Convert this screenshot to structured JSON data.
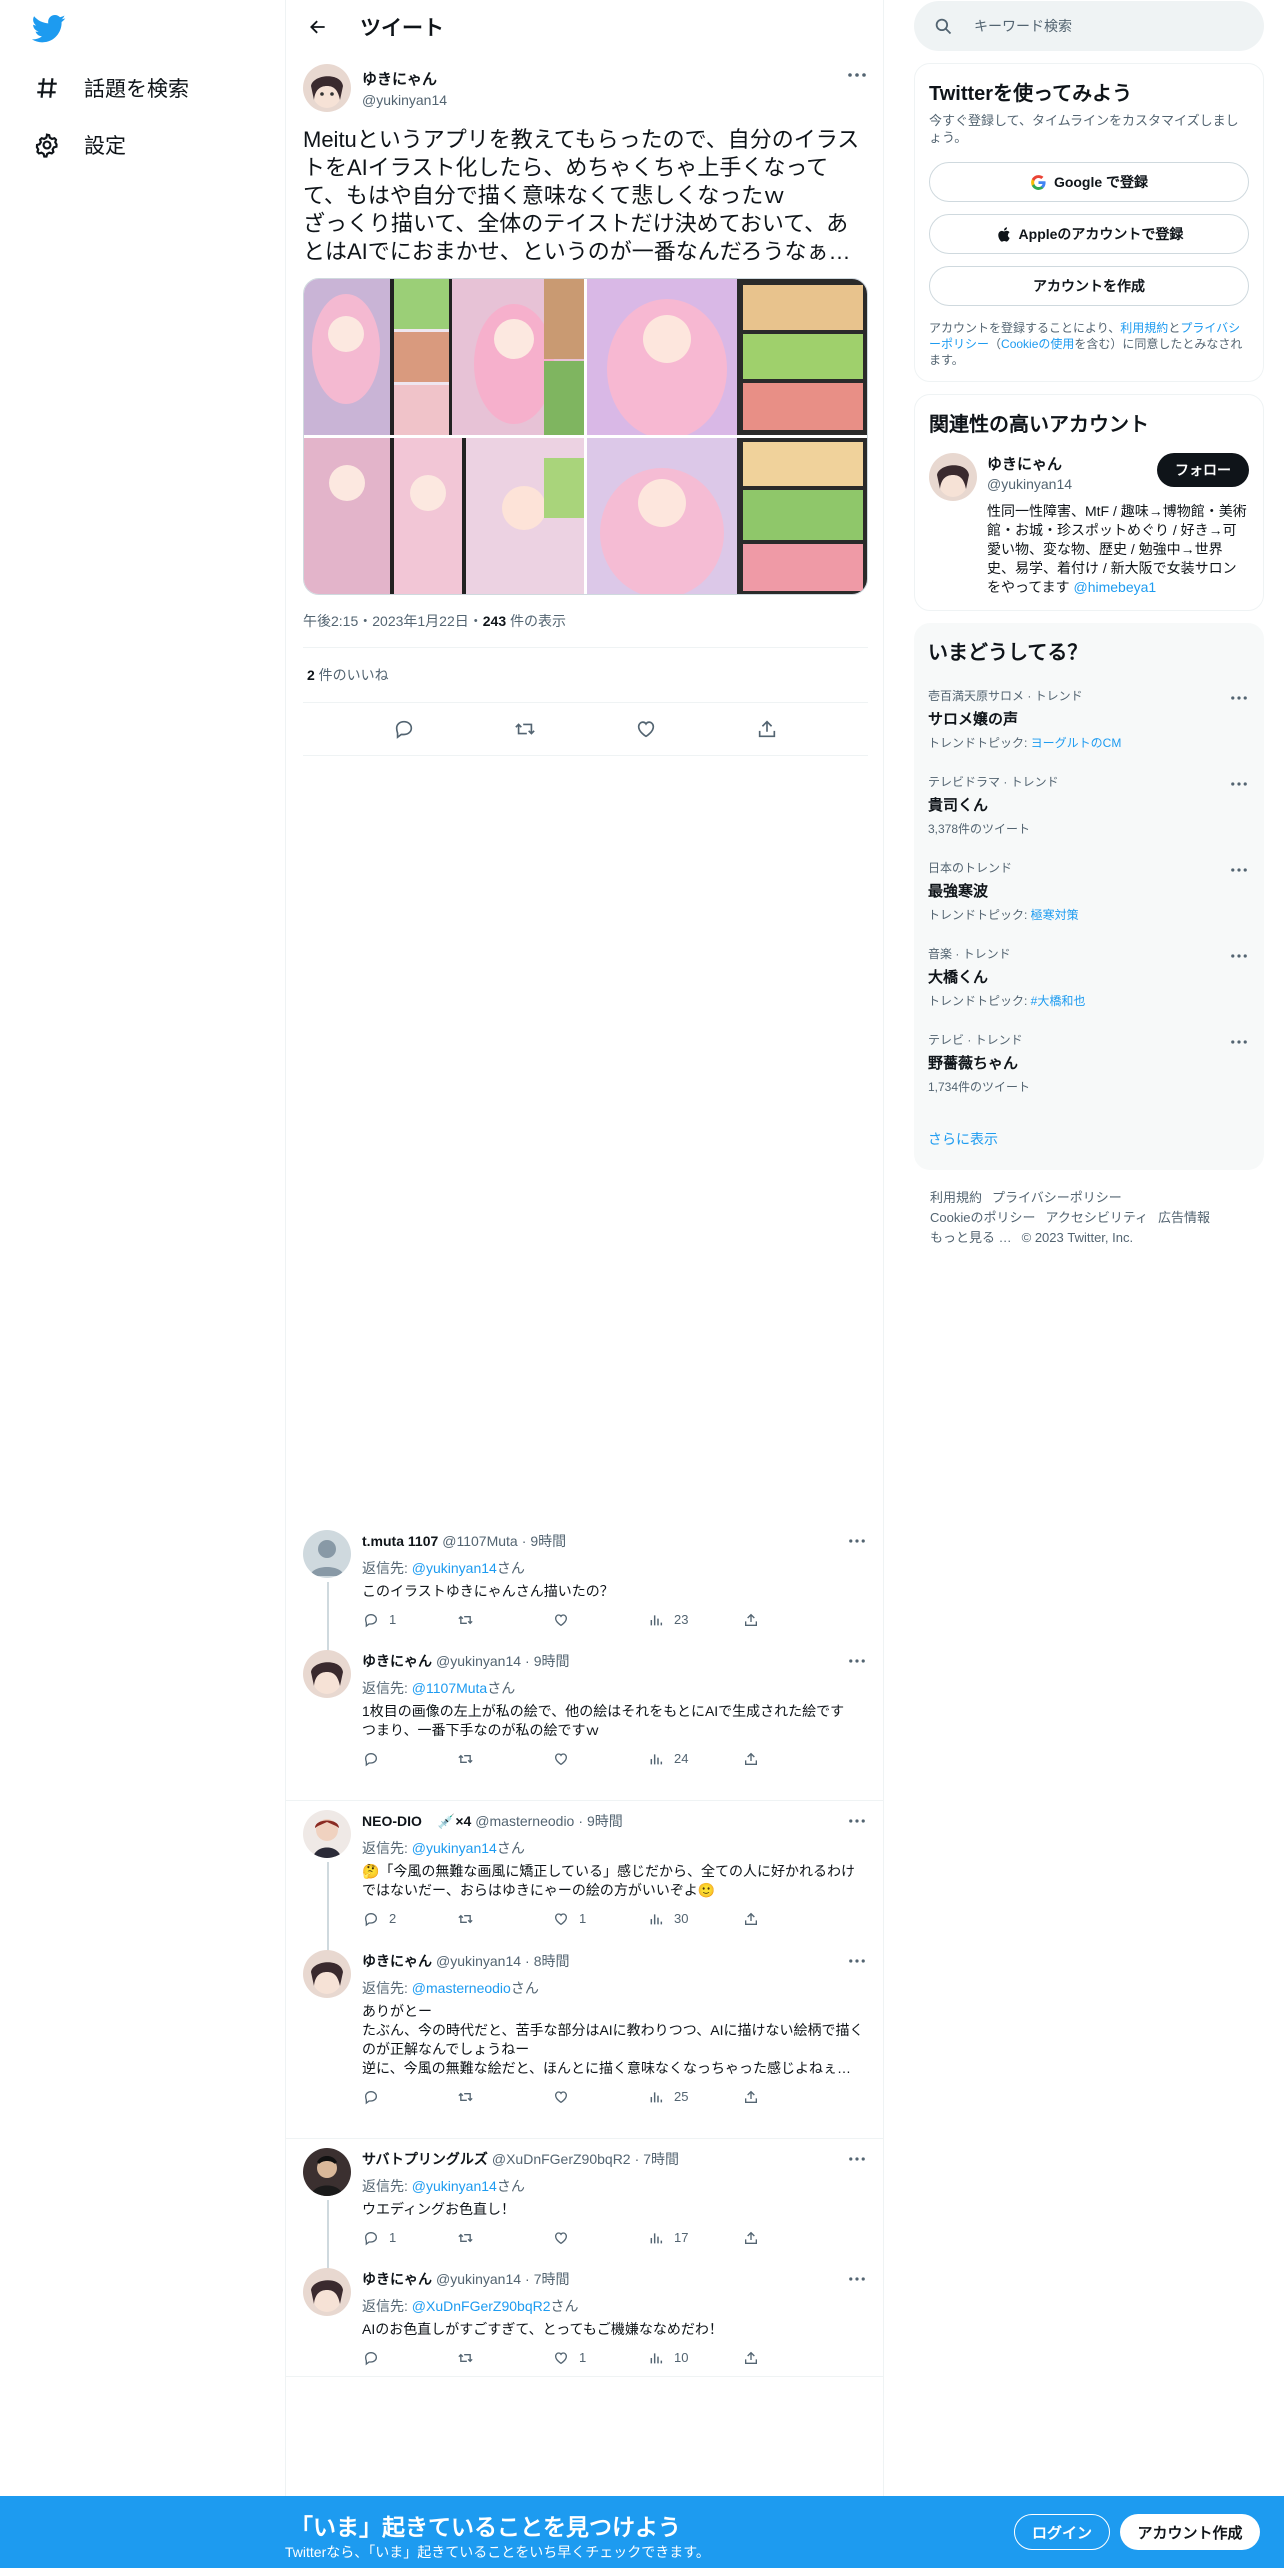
{
  "colors": {
    "accent": "#1d9bf0",
    "text": "#0f1419",
    "muted": "#536471",
    "bottombar": "#1d9bf0"
  },
  "nav": {
    "logo_icon": "twitter-bird-icon",
    "items": [
      {
        "label": "話題を検索",
        "icon": "hashtag-icon"
      },
      {
        "label": "設定",
        "icon": "gear-icon"
      }
    ]
  },
  "header": {
    "title": "ツイート",
    "back_icon": "arrow-left-icon"
  },
  "main_tweet": {
    "name": "ゆきにゃん",
    "handle": "@yukinyan14",
    "text": "Meituというアプリを教えてもらったので、自分のイラストをAIイラスト化したら、めちゃくちゃ上手くなってて、もはや自分で描く意味なくて悲しくなったｗ\nざっくり描いて、全体のテイストだけ決めておいて、あとはAIでにおまかせ、というのが一番なんだろうなぁ…",
    "time": "午後2:15・2023年1月22日・",
    "views": "243",
    "views_label": " 件の表示",
    "likes_count": "2",
    "likes_label": " 件のいいね",
    "media_count": 4
  },
  "replies": [
    {
      "name": "t.muta 1107",
      "handle": "@1107Muta",
      "time": "9時間",
      "reply_prefix": "返信先: ",
      "reply_to": "@yukinyan14",
      "reply_suffix": "さん",
      "body": "このイラストゆきにゃんさん描いたの？",
      "reply_count": "1",
      "retweet_count": "",
      "like_count": "",
      "view_count": "23"
    },
    {
      "name": "ゆきにゃん",
      "handle": "@yukinyan14",
      "time": "9時間",
      "reply_prefix": "返信先: ",
      "reply_to": "@1107Muta",
      "reply_suffix": "さん",
      "body": "1枚目の画像の左上が私の絵で、他の絵はそれをもとにAIで生成された絵です\nつまり、一番下手なのが私の絵ですｗ",
      "reply_count": "",
      "retweet_count": "",
      "like_count": "",
      "view_count": "24"
    },
    {
      "name": "NEO-DIO",
      "badge": "💉×4",
      "handle": "@masterneodio",
      "time": "9時間",
      "reply_prefix": "返信先: ",
      "reply_to": "@yukinyan14",
      "reply_suffix": "さん",
      "body": "🤔「今風の無難な画風に矯正している」感じだから、全ての人に好かれるわけではないだー、おらはゆきにゃーの絵の方がいいぞよ🙂",
      "reply_count": "2",
      "retweet_count": "",
      "like_count": "1",
      "view_count": "30"
    },
    {
      "name": "ゆきにゃん",
      "handle": "@yukinyan14",
      "time": "8時間",
      "reply_prefix": "返信先: ",
      "reply_to": "@masterneodio",
      "reply_suffix": "さん",
      "body": "ありがとー\nたぶん、今の時代だと、苦手な部分はAIに教わりつつ、AIに描けない絵柄で描くのが正解なんでしょうねー\n逆に、今風の無難な絵だと、ほんとに描く意味なくなっちゃった感じよねぇ…",
      "reply_count": "",
      "retweet_count": "",
      "like_count": "",
      "view_count": "25"
    },
    {
      "name": "サバトプリングルズ",
      "handle": "@XuDnFGerZ90bqR2",
      "time": "7時間",
      "reply_prefix": "返信先: ",
      "reply_to": "@yukinyan14",
      "reply_suffix": "さん",
      "body": "ウエディングお色直し！",
      "reply_count": "1",
      "retweet_count": "",
      "like_count": "",
      "view_count": "17"
    },
    {
      "name": "ゆきにゃん",
      "handle": "@yukinyan14",
      "time": "7時間",
      "reply_prefix": "返信先: ",
      "reply_to": "@XuDnFGerZ90bqR2",
      "reply_suffix": "さん",
      "body": "AIのお色直しがすごすぎて、とってもご機嫌ななめだわ！",
      "reply_count": "",
      "retweet_count": "",
      "like_count": "1",
      "view_count": "10"
    }
  ],
  "search": {
    "placeholder": "キーワード検索"
  },
  "signup": {
    "title": "Twitterを使ってみよう",
    "subtitle": "今すぐ登録して、タイムラインをカスタマイズしましょう。",
    "google": "Google で登録",
    "apple": "Appleのアカウントで登録",
    "create": "アカウントを作成",
    "legal_1": "アカウントを登録することにより、",
    "legal_terms": "利用規約",
    "legal_2": "と",
    "legal_privacy": "プライバシーポリシー",
    "legal_3": "（",
    "legal_cookie": "Cookieの使用",
    "legal_4": "を含む）に同意したとみなされます。"
  },
  "related": {
    "title": "関連性の高いアカウント",
    "name": "ゆきにゃん",
    "handle": "@yukinyan14",
    "follow": "フォロー",
    "bio": "性同一性障害、MtF / 趣味→博物館・美術館・お城・珍スポットめぐり / 好き→可愛い物、変な物、歴史 / 勉強中→世界史、易学、着付け / 新大阪で女装サロンをやってます ",
    "bio_link": "@himebeya1"
  },
  "trends": {
    "title": "いまどうしてる？",
    "items": [
      {
        "context": "壱百満天原サロメ · トレンド",
        "name": "サロメ嬢の声",
        "foot_prefix": "トレンドトピック: ",
        "foot_link": "ヨーグルトのCM"
      },
      {
        "context": "テレビドラマ · トレンド",
        "name": "貴司くん",
        "foot_prefix": "3,378件のツイート",
        "foot_link": ""
      },
      {
        "context": "日本のトレンド",
        "name": "最強寒波",
        "foot_prefix": "トレンドトピック: ",
        "foot_link": "極寒対策"
      },
      {
        "context": "音楽 · トレンド",
        "name": "大橋くん",
        "foot_prefix": "トレンドトピック: ",
        "foot_link": "#大橋和也"
      },
      {
        "context": "テレビ · トレンド",
        "name": "野薔薇ちゃん",
        "foot_prefix": "1,734件のツイート",
        "foot_link": ""
      }
    ],
    "show_more": "さらに表示"
  },
  "footer": {
    "terms": "利用規約",
    "privacy": "プライバシーポリシー",
    "cookie": "Cookieのポリシー",
    "access": "アクセシビリティ",
    "ads": "広告情報",
    "more": "もっと見る …",
    "copyright": "© 2023 Twitter, Inc."
  },
  "bottombar": {
    "title": "「いま」起きていることを見つけよう",
    "subtitle": "Twitterなら、「いま」起きていることをいち早くチェックできます。",
    "login": "ログイン",
    "create": "アカウント作成"
  }
}
